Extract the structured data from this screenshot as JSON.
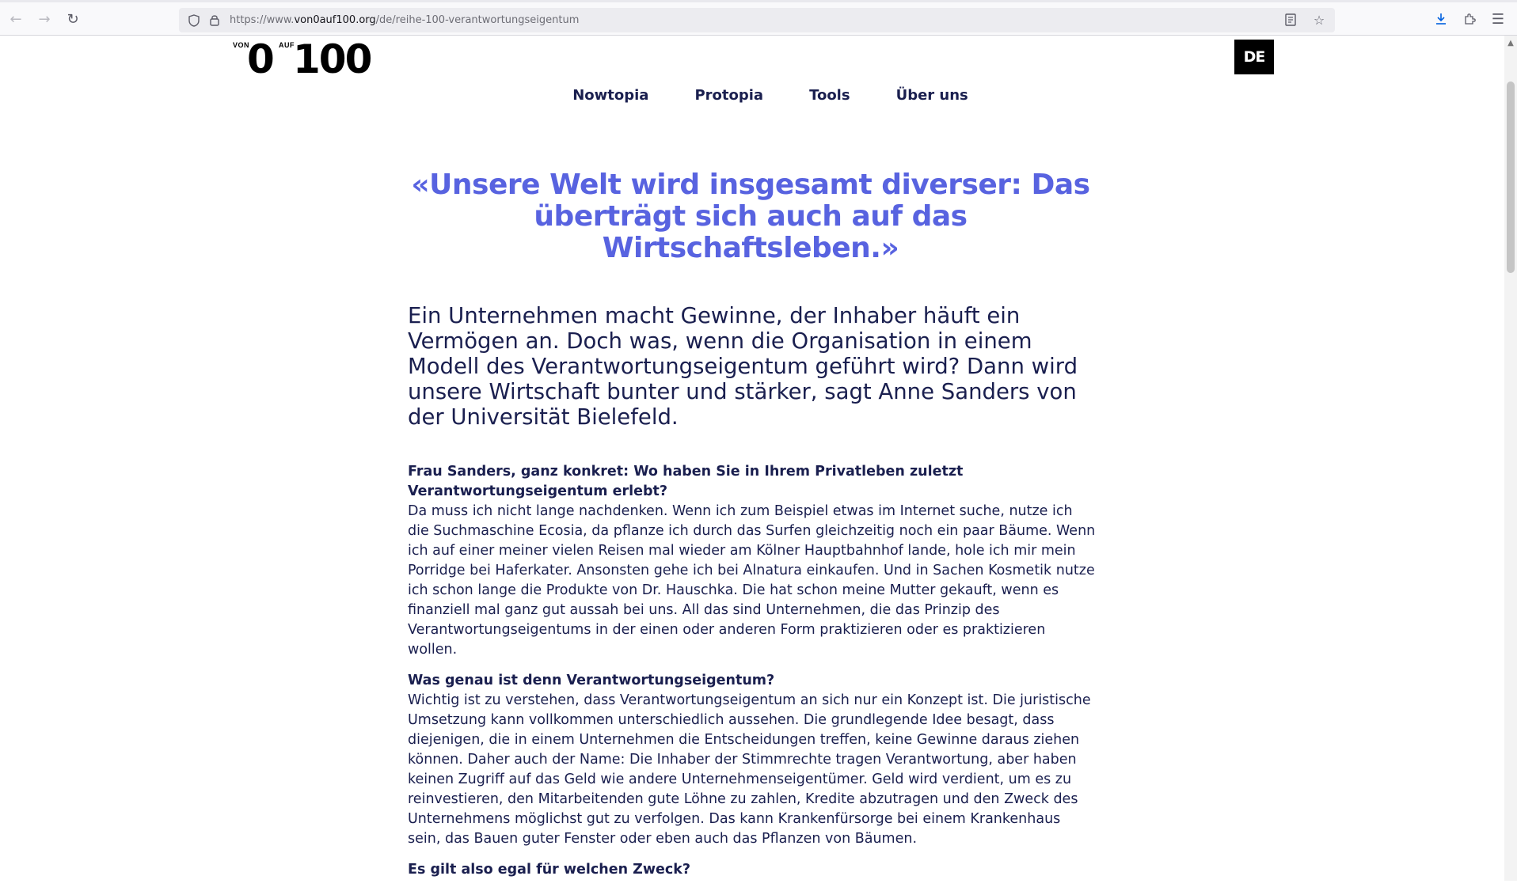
{
  "browser": {
    "url_prefix": "https://www.",
    "url_host": "von0auf100.org",
    "url_path": "/de/reihe-100-verantwortungseigentum",
    "icons": {
      "back": "arrow-left-icon",
      "forward": "arrow-right-icon",
      "reload": "reload-icon",
      "tracking": "shield-icon",
      "lock": "lock-icon",
      "reader": "reader-view-icon",
      "bookmark": "star-icon",
      "downloads": "download-icon",
      "extensions": "puzzle-icon",
      "menu": "hamburger-icon"
    }
  },
  "site": {
    "logo": {
      "von": "VON",
      "zero": "0",
      "auf": "AUF",
      "hundred": "100"
    },
    "language": "DE",
    "nav": [
      "Nowtopia",
      "Protopia",
      "Tools",
      "Über uns"
    ]
  },
  "article": {
    "quote": "«Unsere Welt wird insgesamt diverser: Das überträgt sich auch auf das Wirtschaftsleben.»",
    "lead": "Ein Unternehmen macht Gewinne, der Inhaber häuft ein Vermögen an. Doch was, wenn die Organisation in einem Modell des Verantwortungseigentum geführt wird? Dann wird unsere Wirtschaft bunter und stärker, sagt Anne Sanders von der Universität Bielefeld.",
    "qa": [
      {
        "question": "Frau Sanders, ganz konkret: Wo haben Sie in Ihrem Privatleben zuletzt Verantwortungseigentum erlebt?",
        "answer": "Da muss ich nicht lange nachdenken. Wenn ich zum Beispiel etwas im Internet suche, nutze ich die Suchmaschine Ecosia, da pflanze ich durch das Surfen gleichzeitig noch ein paar Bäume. Wenn ich auf einer meiner vielen Reisen mal wieder am Kölner Hauptbahnhof lande, hole ich mir mein Porridge bei Haferkater. Ansonsten gehe ich bei Alnatura einkaufen. Und in Sachen Kosmetik nutze ich schon lange die Produkte von Dr. Hauschka. Die hat schon meine Mutter gekauft, wenn es finanziell mal ganz gut aussah bei uns. All das sind Unternehmen, die das Prinzip des Verantwortungseigentums in der einen oder anderen Form praktizieren oder es praktizieren wollen."
      },
      {
        "question": "Was genau ist denn Verantwortungseigentum?",
        "answer": "Wichtig ist zu verstehen, dass Verantwortungseigentum an sich nur ein Konzept ist. Die juristische Umsetzung kann vollkommen unterschiedlich aussehen. Die grundlegende Idee besagt, dass diejenigen, die in einem Unternehmen die Entscheidungen treffen, keine Gewinne daraus ziehen können. Daher auch der Name: Die Inhaber der Stimmrechte tragen Verantwortung, aber haben keinen Zugriff auf das Geld wie andere Unternehmenseigentümer. Geld wird verdient, um es zu reinvestieren, den Mitarbeitenden gute Löhne zu zahlen, Kredite abzutragen und den Zweck des Unternehmens möglichst gut zu verfolgen. Das kann Krankenfürsorge bei einem Krankenhaus sein, das Bauen guter Fenster oder eben auch das Pflanzen von Bäumen."
      },
      {
        "question": "Es gilt also egal für welchen Zweck?",
        "answer": ""
      }
    ]
  }
}
